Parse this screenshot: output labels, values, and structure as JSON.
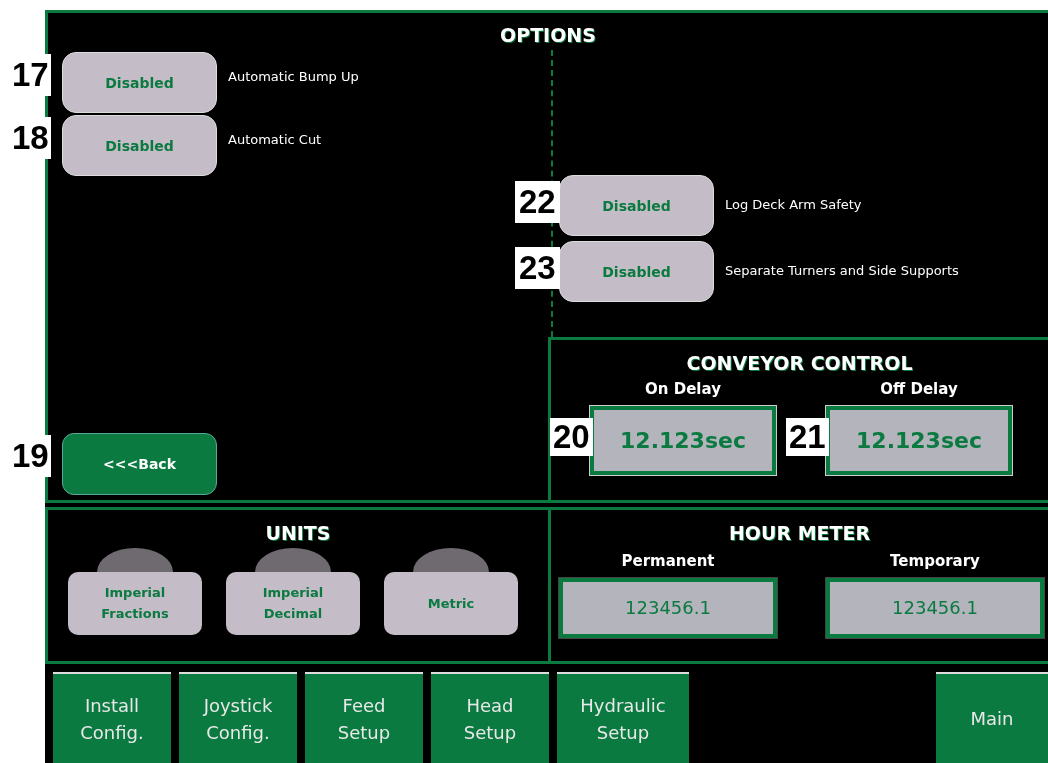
{
  "options": {
    "title": "OPTIONS",
    "left_items": [
      {
        "callout": "17",
        "value": "Disabled",
        "label": "Automatic Bump Up"
      },
      {
        "callout": "18",
        "value": "Disabled",
        "label": "Automatic Cut"
      }
    ],
    "right_items": [
      {
        "callout": "22",
        "value": "Disabled",
        "label": "Log Deck Arm Safety"
      },
      {
        "callout": "23",
        "value": "Disabled",
        "label": "Separate Turners and Side Supports"
      }
    ],
    "back_button": {
      "callout": "19",
      "label": "<<<Back"
    }
  },
  "conveyor_control": {
    "title": "CONVEYOR CONTROL",
    "fields": [
      {
        "label": "On Delay",
        "callout": "20",
        "value": "12.123sec"
      },
      {
        "label": "Off Delay",
        "callout": "21",
        "value": "12.123sec"
      }
    ]
  },
  "units": {
    "title": "UNITS",
    "buttons": [
      {
        "lines": [
          "Imperial",
          "Fractions"
        ]
      },
      {
        "lines": [
          "Imperial",
          "Decimal"
        ]
      },
      {
        "lines": [
          "Metric"
        ]
      }
    ]
  },
  "hour_meter": {
    "title": "HOUR METER",
    "fields": [
      {
        "label": "Permanent",
        "value": "123456.1"
      },
      {
        "label": "Temporary",
        "value": "123456.1"
      }
    ]
  },
  "nav": [
    {
      "lines": [
        "Install",
        "Config."
      ]
    },
    {
      "lines": [
        "Joystick",
        "Config."
      ]
    },
    {
      "lines": [
        "Feed",
        "Setup"
      ]
    },
    {
      "lines": [
        "Head",
        "Setup"
      ]
    },
    {
      "lines": [
        "Hydraulic",
        "Setup"
      ]
    }
  ],
  "main_button": {
    "label": "Main"
  }
}
